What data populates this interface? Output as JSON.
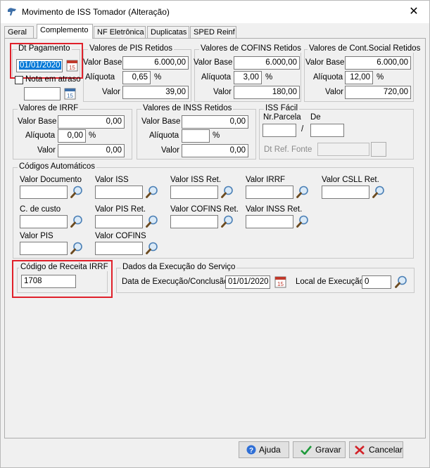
{
  "window": {
    "title": "Movimento de ISS Tomador (Alteração)",
    "close": "✕"
  },
  "tabs": [
    "Geral",
    "Complemento",
    "NF Eletrônica",
    "Duplicatas",
    "SPED Reinf"
  ],
  "pagamento": {
    "group_label": "Dt Pagamento",
    "date": "01/01/2020",
    "nota_em_atraso": "Nota em atraso",
    "nota_date": ""
  },
  "pis": {
    "group_label": "Valores de PIS Retidos",
    "valor_base_label": "Valor Base",
    "valor_base": "6.000,00",
    "aliquota_label": "Alíquota",
    "aliquota": "0,65",
    "pct": "%",
    "valor_label": "Valor",
    "valor": "39,00"
  },
  "cofins": {
    "group_label": "Valores de COFINS Retidos",
    "valor_base_label": "Valor Base",
    "valor_base": "6.000,00",
    "aliquota_label": "Alíquota",
    "aliquota": "3,00",
    "pct": "%",
    "valor_label": "Valor",
    "valor": "180,00"
  },
  "csll": {
    "group_label": "Valores de Cont.Social Retidos",
    "valor_base_label": "Valor Base",
    "valor_base": "6.000,00",
    "aliquota_label": "Alíquota",
    "aliquota": "12,00",
    "pct": "%",
    "valor_label": "Valor",
    "valor": "720,00"
  },
  "irrf": {
    "group_label": "Valores de IRRF",
    "valor_base_label": "Valor Base",
    "valor_base": "0,00",
    "aliquota_label": "Alíquota",
    "aliquota": "0,00",
    "pct": "%",
    "valor_label": "Valor",
    "valor": "0,00"
  },
  "inss": {
    "group_label": "Valores de INSS Retidos",
    "valor_base_label": "Valor Base",
    "valor_base": "0,00",
    "aliquota_label": "Alíquota",
    "aliquota": "",
    "pct": "%",
    "valor_label": "Valor",
    "valor": "0,00"
  },
  "iss_facil": {
    "group_label": "ISS Fácil",
    "nr_parcela_label": "Nr.Parcela",
    "de_label": "De",
    "slash": "/",
    "nr_parcela": "",
    "de": "",
    "dt_ref_label": "Dt Ref. Fonte",
    "dt_ref": ""
  },
  "codigos": {
    "group_label": "Códigos Automáticos",
    "fields": {
      "valor_documento": "Valor Documento",
      "valor_iss": "Valor ISS",
      "valor_iss_ret": "Valor ISS Ret.",
      "valor_irrf": "Valor IRRF",
      "valor_csll_ret": "Valor CSLL Ret.",
      "c_de_custo": "C. de custo",
      "valor_pis_ret": "Valor PIS Ret.",
      "valor_cofins_ret": "Valor COFINS Ret.",
      "valor_inss_ret": "Valor INSS Ret.",
      "valor_pis": "Valor PIS",
      "valor_cofins": "Valor COFINS"
    }
  },
  "receita": {
    "group_label": "Código de Receita IRRF",
    "value": "1708"
  },
  "execucao": {
    "group_label": "Dados da Execução do Serviço",
    "data_label": "Data de Execução/Conclusão",
    "data": "01/01/2020",
    "local_label": "Local de Execução",
    "local": "0"
  },
  "buttons": {
    "ajuda": "Ajuda",
    "gravar": "Gravar",
    "cancelar": "Cancelar"
  },
  "colors": {
    "highlight": "#e0202a",
    "selection": "#0078d7"
  }
}
